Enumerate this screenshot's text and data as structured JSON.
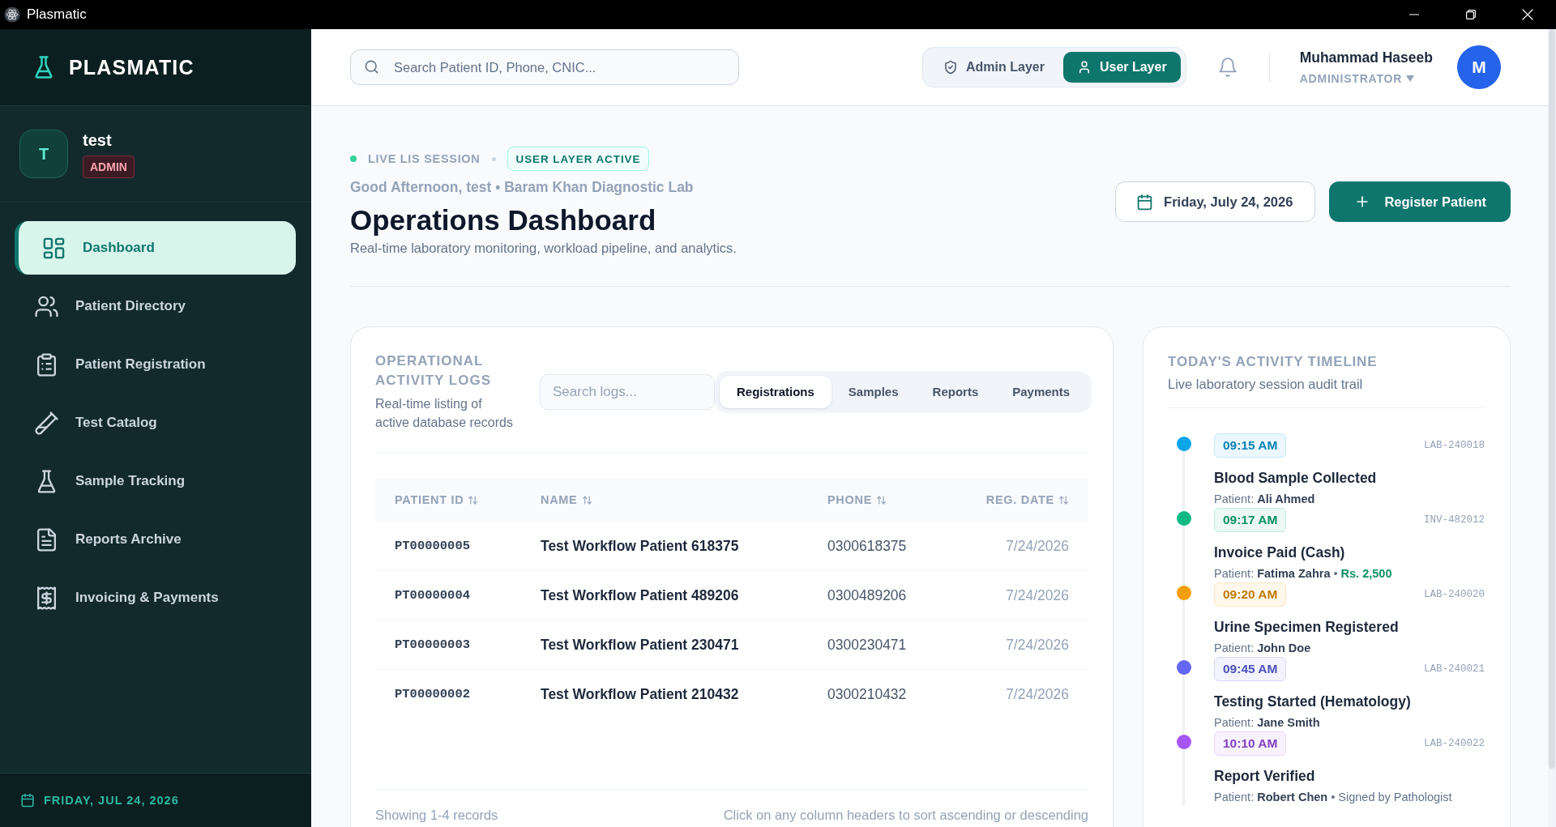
{
  "window": {
    "title": "Plasmatic"
  },
  "sidebar": {
    "brand": "PLASMATIC",
    "user": {
      "initial": "T",
      "name": "test",
      "role": "ADMIN"
    },
    "items": [
      {
        "label": "Dashboard",
        "selected": true
      },
      {
        "label": "Patient Directory",
        "selected": false
      },
      {
        "label": "Patient Registration",
        "selected": false
      },
      {
        "label": "Test Catalog",
        "selected": false
      },
      {
        "label": "Sample Tracking",
        "selected": false
      },
      {
        "label": "Reports Archive",
        "selected": false
      },
      {
        "label": "Invoicing & Payments",
        "selected": false
      }
    ],
    "footer_date": "FRIDAY, JUL 24, 2026"
  },
  "header": {
    "search": {
      "placeholder": "Search Patient ID, Phone, CNIC..."
    },
    "layers": [
      {
        "label": "Admin Layer",
        "selected": false
      },
      {
        "label": "User Layer",
        "selected": true
      }
    ],
    "user": {
      "name": "Muhammad Haseeb",
      "role": "ADMINISTRATOR",
      "initial": "M"
    }
  },
  "page": {
    "session": "LIVE LIS SESSION",
    "layer_badge": "USER LAYER ACTIVE",
    "greeting": "Good Afternoon, test • Baram Khan Diagnostic Lab",
    "title": "Operations Dashboard",
    "subtitle": "Real-time laboratory monitoring, workload pipeline, and analytics.",
    "date_button": "Friday, July 24, 2026",
    "register_button": "Register Patient"
  },
  "logs": {
    "title": "OPERATIONAL ACTIVITY LOGS",
    "subtitle": "Real-time listing of active database records",
    "search": {
      "placeholder": "Search logs..."
    },
    "tabs": [
      {
        "label": "Registrations",
        "selected": true
      },
      {
        "label": "Samples",
        "selected": false
      },
      {
        "label": "Reports",
        "selected": false
      },
      {
        "label": "Payments",
        "selected": false
      }
    ],
    "table": {
      "columns": [
        "PATIENT ID",
        "NAME",
        "PHONE",
        "REG. DATE"
      ],
      "rows": [
        [
          "PT00000005",
          "Test Workflow Patient 618375",
          "0300618375",
          "7/24/2026"
        ],
        [
          "PT00000004",
          "Test Workflow Patient 489206",
          "0300489206",
          "7/24/2026"
        ],
        [
          "PT00000003",
          "Test Workflow Patient 230471",
          "0300230471",
          "7/24/2026"
        ],
        [
          "PT00000002",
          "Test Workflow Patient 210432",
          "0300210432",
          "7/24/2026"
        ]
      ]
    },
    "footer_left": "Showing 1-4 records",
    "footer_right": "Click on any column headers to sort ascending or descending"
  },
  "timeline": {
    "title": "TODAY'S ACTIVITY TIMELINE",
    "subtitle": "Live laboratory session audit trail",
    "events": [
      {
        "time": "09:15 AM",
        "ref": "LAB-240018",
        "title": "Blood Sample Collected",
        "detail": "Patient: **Ali Ahmed**",
        "color": "#0ea5e9"
      },
      {
        "time": "09:17 AM",
        "ref": "INV-482012",
        "title": "Invoice Paid (Cash)",
        "detail": "Patient: **Fatima Zahra** •",
        "amount": "Rs. 2,500",
        "color": "#10b981"
      },
      {
        "time": "09:20 AM",
        "ref": "LAB-240020",
        "title": "Urine Specimen Registered",
        "detail": "Patient: **John Doe**",
        "color": "#f59e0b"
      },
      {
        "time": "09:45 AM",
        "ref": "LAB-240021",
        "title": "Testing Started (Hematology)",
        "detail": "Patient: **Jane Smith**",
        "color": "#6366f1"
      },
      {
        "time": "10:10 AM",
        "ref": "LAB-240022",
        "title": "Report Verified",
        "detail": "Patient: **Robert Chen** • Signed by Pathologist",
        "color": "#a855f7"
      }
    ]
  }
}
